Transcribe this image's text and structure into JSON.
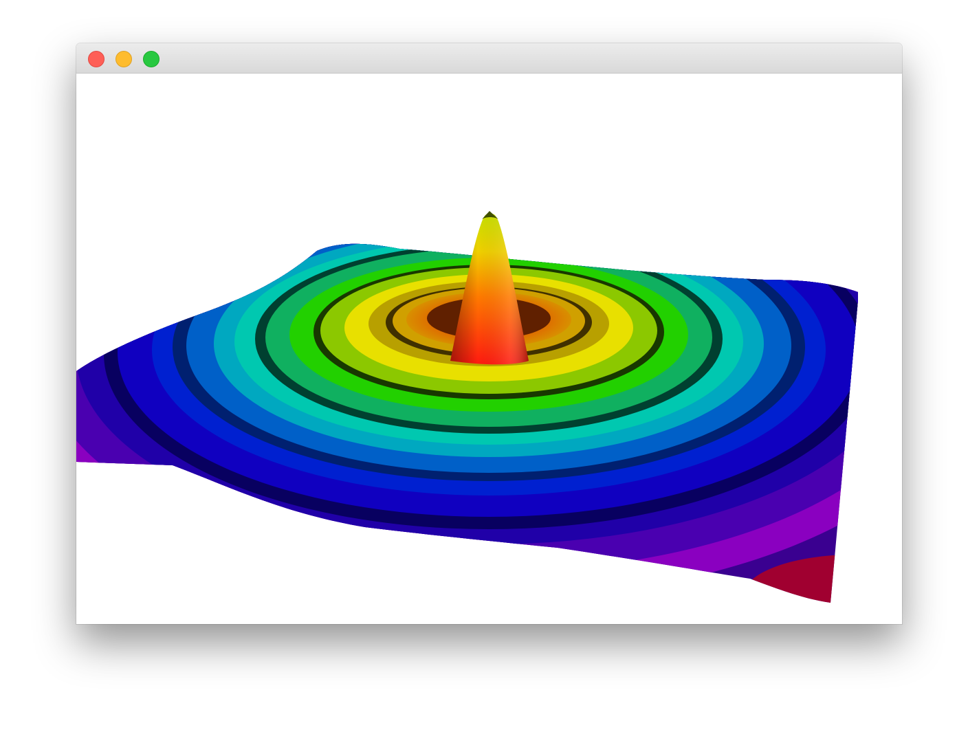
{
  "window": {
    "title": "",
    "controls": [
      {
        "name": "close",
        "color": "#fe5f57",
        "border": "#e14942"
      },
      {
        "name": "minimize",
        "color": "#febc2e",
        "border": "#dea123"
      },
      {
        "name": "zoom",
        "color": "#28c840",
        "border": "#1aab29"
      }
    ]
  },
  "scene": {
    "type": "3d-surface-plot",
    "description_colors": {
      "peak": "#ff2010",
      "ring_yellow": "#e8e000",
      "ring_green": "#22d000",
      "ring_cyan": "#00c8b0",
      "ring_blue": "#0010d0",
      "outer_purple": "#7a00b8",
      "corner_red": "#c00010",
      "background": "#ffffff"
    }
  }
}
